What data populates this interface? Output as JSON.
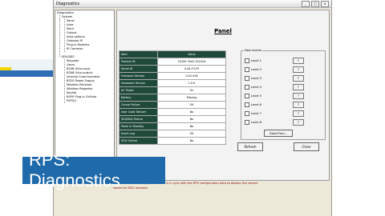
{
  "window": {
    "title": "Diagnostics",
    "min": "_",
    "max": "□",
    "close": "x"
  },
  "tree": {
    "root": "Diagnostics",
    "system": "System",
    "system_children": [
      "Panel",
      "Area",
      "Point",
      "Output",
      "Area options",
      "Onboard IP",
      "Plug-in Modules",
      "IP Cameras"
    ],
    "sdi_group": "SDI/SDI2",
    "sdi_children": [
      "Keypads",
      "Users",
      "B208 Octo-input",
      "B308 Octo-output",
      "Internal Communicator",
      "B520 Power Supply",
      "Wireless Receiver",
      "Wireless Repeater",
      "Keyfob",
      "B450 Plug-in Cellular",
      "PSPS/1"
    ]
  },
  "panel": {
    "title": "Panel",
    "table_header": {
      "key": "Item",
      "value": "Value"
    },
    "rows": [
      {
        "key": "Product ID",
        "value": "20185 3942 342416"
      },
      {
        "key": "Serial ID",
        "value": "0.A4.F3.F9"
      },
      {
        "key": "Firmware Version",
        "value": "3.02.016"
      },
      {
        "key": "Hardware Version",
        "value": "1.0.0"
      },
      {
        "key": "AC Power",
        "value": "On"
      },
      {
        "key": "Battery",
        "value": "Missing"
      },
      {
        "key": "Comm Failure",
        "value": "OK"
      },
      {
        "key": "User Code Tamper",
        "value": "No"
      },
      {
        "key": "SDI/SDI2 Failure",
        "value": "No"
      },
      {
        "key": "Panel in Standby",
        "value": "No"
      },
      {
        "key": "Event Log",
        "value": "OK"
      },
      {
        "key": "SDI2 Failure",
        "value": "No"
      }
    ]
  },
  "events": {
    "legend": "New events",
    "levels": [
      "Level 1",
      "Level 2",
      "Level 3",
      "Level 4",
      "Level 5",
      "Level 6",
      "Level 7",
      "Level 8"
    ],
    "q_label": "?",
    "date_time": "Date/Time..."
  },
  "buttons": {
    "refresh": "Refresh",
    "close": "Close"
  },
  "status": {
    "line1": "the Control Panel configuration data is in sync with the RPS configuration data to display the correct",
    "line2": "status for SDI2 modules"
  },
  "caption": "RPS: Diagnostics"
}
